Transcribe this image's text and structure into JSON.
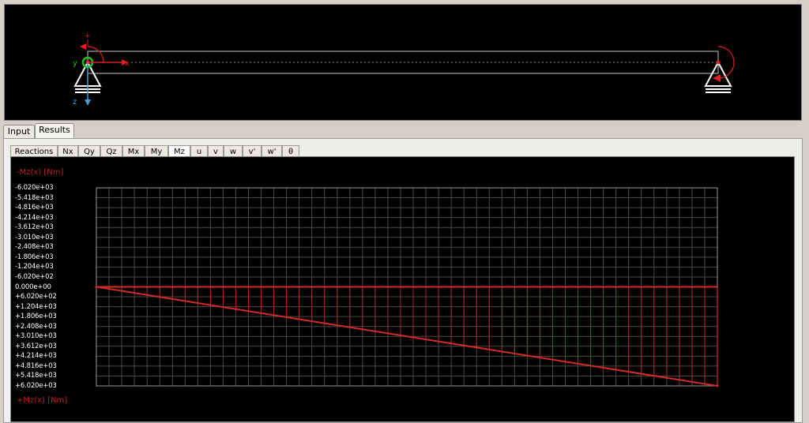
{
  "beam_view": {
    "axis_labels": {
      "x": "x",
      "y": "y",
      "z": "z",
      "plus": "+"
    },
    "colors": {
      "beam": "#c8c8c8",
      "force": "#e02020",
      "y_axis": "#20c020",
      "z_axis": "#3aa0e0"
    }
  },
  "main_tabs": [
    {
      "label": "Input",
      "active": false
    },
    {
      "label": "Results",
      "active": true
    }
  ],
  "result_tabs": [
    {
      "label": "Reactions",
      "active": false
    },
    {
      "label": "Nx",
      "active": false
    },
    {
      "label": "Qy",
      "active": false
    },
    {
      "label": "Qz",
      "active": false
    },
    {
      "label": "Mx",
      "active": false
    },
    {
      "label": "My",
      "active": false
    },
    {
      "label": "Mz",
      "active": true
    },
    {
      "label": "u",
      "active": false
    },
    {
      "label": "v",
      "active": false
    },
    {
      "label": "w",
      "active": false
    },
    {
      "label": "v'",
      "active": false
    },
    {
      "label": "w'",
      "active": false
    },
    {
      "label": "θ",
      "active": false
    }
  ],
  "plot": {
    "top_label": "-Mz(x) [Nm]",
    "bottom_label": "+Mz(x) [Nm]",
    "tick_labels": [
      "-6.020e+03",
      "-5.418e+03",
      "-4.816e+03",
      "-4.214e+03",
      "-3.612e+03",
      "-3.010e+03",
      "-2.408e+03",
      "-1.806e+03",
      "-1.204e+03",
      "-6.020e+02",
      "0.000e+00",
      "+6.020e+02",
      "+1.204e+03",
      "+1.806e+03",
      "+2.408e+03",
      "+3.010e+03",
      "+3.612e+03",
      "+4.214e+03",
      "+4.816e+03",
      "+5.418e+03",
      "+6.020e+03"
    ],
    "colors": {
      "background": "#000000",
      "grid": "#4a4a4a",
      "frame": "#9a9a9a",
      "curve": "#d42a2a",
      "hatch": "#b02424",
      "axis_text": "#ffffff",
      "label": "#c0201e"
    }
  },
  "chart_data": {
    "type": "area",
    "ylabel": "-Mz(x) [Nm]",
    "ylabel_bottom": "+Mz(x) [Nm]",
    "ylim": [
      -6020,
      6020
    ],
    "y_inverted": true,
    "x": [
      0,
      1
    ],
    "series": [
      {
        "values": [
          0,
          6020
        ]
      }
    ],
    "grid": true
  }
}
